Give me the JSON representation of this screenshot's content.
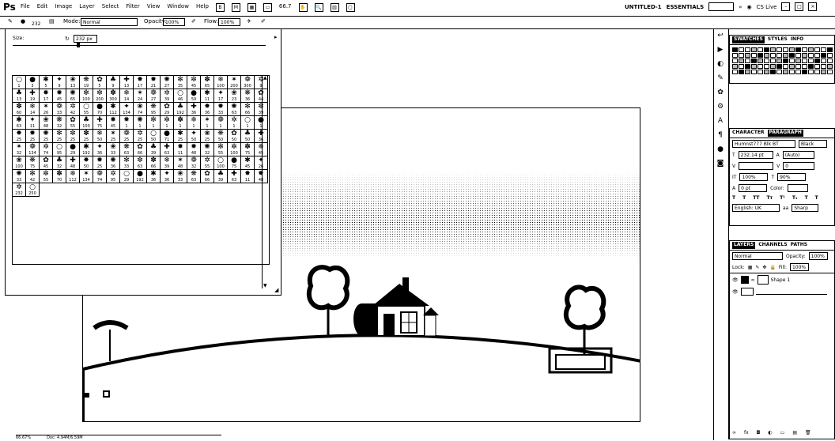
{
  "menubar": {
    "logo": "Ps",
    "menus": [
      "File",
      "Edit",
      "Image",
      "Layer",
      "Select",
      "Filter",
      "View",
      "Window",
      "Help"
    ],
    "zoom": "66.7",
    "doc_name": "UNTITLED-1",
    "workspace": "ESSENTIALS",
    "cs_live": "CS Live"
  },
  "options": {
    "brush_size": "232",
    "mode_label": "Mode:",
    "mode_value": "Normal",
    "opacity_label": "Opacity:",
    "opacity_value": "100%",
    "flow_label": "Flow:",
    "flow_value": "100%"
  },
  "brush_picker": {
    "size_label": "Size:",
    "size_value": "232 px",
    "rows": [
      [
        "1",
        "3",
        "5",
        "9",
        "13",
        "19",
        "5",
        "9",
        "13",
        "17",
        "21",
        "27",
        "35",
        "45",
        "65",
        "100",
        "200",
        "300",
        "9"
      ],
      [
        "13",
        "19",
        "17",
        "45",
        "65",
        "100",
        "200",
        "300",
        "14",
        "24",
        "27",
        "39",
        "46",
        "59",
        "11",
        "17",
        "23",
        "36",
        "44"
      ],
      [
        "60",
        "14",
        "26",
        "33",
        "42",
        "55",
        "70",
        "112",
        "134",
        "74",
        "95",
        "29",
        "192",
        "36",
        "36",
        "33",
        "63",
        "66",
        "39"
      ],
      [
        "63",
        "11",
        "48",
        "32",
        "55",
        "100",
        "75",
        "45",
        "1",
        "1",
        "1",
        "1",
        "1",
        "1",
        "1",
        "1",
        "1",
        "1",
        "1"
      ],
      [
        "25",
        "25",
        "25",
        "25",
        "25",
        "25",
        "50",
        "25",
        "25",
        "25",
        "50",
        "71",
        "25",
        "50",
        "25",
        "50",
        "50",
        "50",
        "36"
      ],
      [
        "32",
        "134",
        "74",
        "95",
        "29",
        "192",
        "36",
        "33",
        "63",
        "66",
        "39",
        "63",
        "11",
        "48",
        "32",
        "55",
        "100",
        "75",
        "45"
      ],
      [
        "100",
        "75",
        "45",
        "32",
        "48",
        "50",
        "25",
        "36",
        "33",
        "63",
        "66",
        "39",
        "48",
        "32",
        "55",
        "100",
        "75",
        "45",
        "26"
      ],
      [
        "33",
        "42",
        "55",
        "70",
        "112",
        "134",
        "74",
        "95",
        "29",
        "192",
        "36",
        "36",
        "33",
        "63",
        "66",
        "39",
        "63",
        "11",
        "48"
      ],
      [
        "232",
        "250"
      ]
    ]
  },
  "panels": {
    "swatches_tabs": [
      "SWATCHES",
      "STYLES",
      "INFO"
    ],
    "character_tabs": [
      "CHARACTER",
      "PARAGRAPH"
    ],
    "font_family": "Humnst777 Blk BT",
    "font_style": "Black",
    "font_size": "232.14 pt",
    "leading": "(Auto)",
    "tracking": "0",
    "vscale": "100%",
    "hscale": "90%",
    "baseline": "0 pt",
    "color_label": "Color:",
    "language": "English: UK",
    "antialias": "Sharp",
    "layers_tabs": [
      "LAYERS",
      "CHANNELS",
      "PATHS"
    ],
    "blend_mode": "Normal",
    "opacity_label": "Opacity:",
    "opacity_value": "100%",
    "lock_label": "Lock:",
    "fill_label": "Fill:",
    "fill_value": "100%",
    "layer_name": "Shape 1"
  },
  "status": {
    "zoom": "66.67%",
    "doc_info": "Doc: 4.94M/6.59M"
  }
}
